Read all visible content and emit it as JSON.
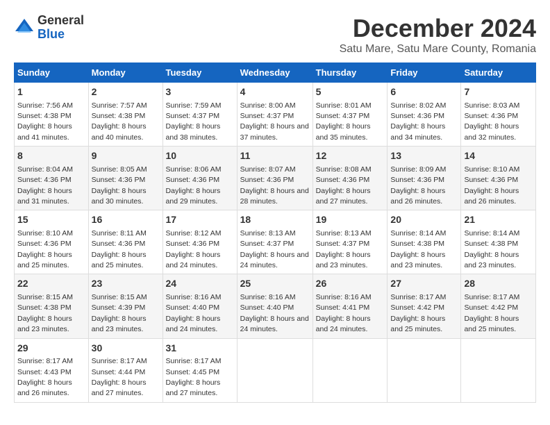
{
  "logo": {
    "general": "General",
    "blue": "Blue"
  },
  "title": "December 2024",
  "subtitle": "Satu Mare, Satu Mare County, Romania",
  "headers": [
    "Sunday",
    "Monday",
    "Tuesday",
    "Wednesday",
    "Thursday",
    "Friday",
    "Saturday"
  ],
  "weeks": [
    [
      {
        "day": "1",
        "sunrise": "7:56 AM",
        "sunset": "4:38 PM",
        "daylight": "8 hours and 41 minutes."
      },
      {
        "day": "2",
        "sunrise": "7:57 AM",
        "sunset": "4:38 PM",
        "daylight": "8 hours and 40 minutes."
      },
      {
        "day": "3",
        "sunrise": "7:59 AM",
        "sunset": "4:37 PM",
        "daylight": "8 hours and 38 minutes."
      },
      {
        "day": "4",
        "sunrise": "8:00 AM",
        "sunset": "4:37 PM",
        "daylight": "8 hours and 37 minutes."
      },
      {
        "day": "5",
        "sunrise": "8:01 AM",
        "sunset": "4:37 PM",
        "daylight": "8 hours and 35 minutes."
      },
      {
        "day": "6",
        "sunrise": "8:02 AM",
        "sunset": "4:36 PM",
        "daylight": "8 hours and 34 minutes."
      },
      {
        "day": "7",
        "sunrise": "8:03 AM",
        "sunset": "4:36 PM",
        "daylight": "8 hours and 32 minutes."
      }
    ],
    [
      {
        "day": "8",
        "sunrise": "8:04 AM",
        "sunset": "4:36 PM",
        "daylight": "8 hours and 31 minutes."
      },
      {
        "day": "9",
        "sunrise": "8:05 AM",
        "sunset": "4:36 PM",
        "daylight": "8 hours and 30 minutes."
      },
      {
        "day": "10",
        "sunrise": "8:06 AM",
        "sunset": "4:36 PM",
        "daylight": "8 hours and 29 minutes."
      },
      {
        "day": "11",
        "sunrise": "8:07 AM",
        "sunset": "4:36 PM",
        "daylight": "8 hours and 28 minutes."
      },
      {
        "day": "12",
        "sunrise": "8:08 AM",
        "sunset": "4:36 PM",
        "daylight": "8 hours and 27 minutes."
      },
      {
        "day": "13",
        "sunrise": "8:09 AM",
        "sunset": "4:36 PM",
        "daylight": "8 hours and 26 minutes."
      },
      {
        "day": "14",
        "sunrise": "8:10 AM",
        "sunset": "4:36 PM",
        "daylight": "8 hours and 26 minutes."
      }
    ],
    [
      {
        "day": "15",
        "sunrise": "8:10 AM",
        "sunset": "4:36 PM",
        "daylight": "8 hours and 25 minutes."
      },
      {
        "day": "16",
        "sunrise": "8:11 AM",
        "sunset": "4:36 PM",
        "daylight": "8 hours and 25 minutes."
      },
      {
        "day": "17",
        "sunrise": "8:12 AM",
        "sunset": "4:36 PM",
        "daylight": "8 hours and 24 minutes."
      },
      {
        "day": "18",
        "sunrise": "8:13 AM",
        "sunset": "4:37 PM",
        "daylight": "8 hours and 24 minutes."
      },
      {
        "day": "19",
        "sunrise": "8:13 AM",
        "sunset": "4:37 PM",
        "daylight": "8 hours and 23 minutes."
      },
      {
        "day": "20",
        "sunrise": "8:14 AM",
        "sunset": "4:38 PM",
        "daylight": "8 hours and 23 minutes."
      },
      {
        "day": "21",
        "sunrise": "8:14 AM",
        "sunset": "4:38 PM",
        "daylight": "8 hours and 23 minutes."
      }
    ],
    [
      {
        "day": "22",
        "sunrise": "8:15 AM",
        "sunset": "4:38 PM",
        "daylight": "8 hours and 23 minutes."
      },
      {
        "day": "23",
        "sunrise": "8:15 AM",
        "sunset": "4:39 PM",
        "daylight": "8 hours and 23 minutes."
      },
      {
        "day": "24",
        "sunrise": "8:16 AM",
        "sunset": "4:40 PM",
        "daylight": "8 hours and 24 minutes."
      },
      {
        "day": "25",
        "sunrise": "8:16 AM",
        "sunset": "4:40 PM",
        "daylight": "8 hours and 24 minutes."
      },
      {
        "day": "26",
        "sunrise": "8:16 AM",
        "sunset": "4:41 PM",
        "daylight": "8 hours and 24 minutes."
      },
      {
        "day": "27",
        "sunrise": "8:17 AM",
        "sunset": "4:42 PM",
        "daylight": "8 hours and 25 minutes."
      },
      {
        "day": "28",
        "sunrise": "8:17 AM",
        "sunset": "4:42 PM",
        "daylight": "8 hours and 25 minutes."
      }
    ],
    [
      {
        "day": "29",
        "sunrise": "8:17 AM",
        "sunset": "4:43 PM",
        "daylight": "8 hours and 26 minutes."
      },
      {
        "day": "30",
        "sunrise": "8:17 AM",
        "sunset": "4:44 PM",
        "daylight": "8 hours and 27 minutes."
      },
      {
        "day": "31",
        "sunrise": "8:17 AM",
        "sunset": "4:45 PM",
        "daylight": "8 hours and 27 minutes."
      },
      null,
      null,
      null,
      null
    ]
  ]
}
